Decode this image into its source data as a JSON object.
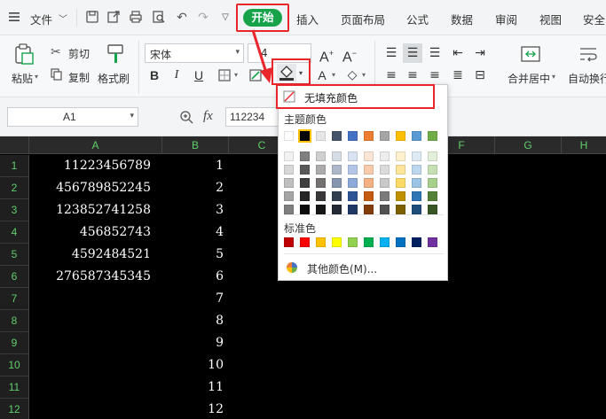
{
  "menubar": {
    "file_label": "文件",
    "tabs": [
      "开始",
      "插入",
      "页面布局",
      "公式",
      "数据",
      "审阅",
      "视图",
      "安全"
    ]
  },
  "ribbon": {
    "paste": "粘贴",
    "cut": "剪切",
    "copy": "复制",
    "format_painter": "格式刷",
    "font_name": "宋体",
    "font_size": "4",
    "merge_center": "合并居中",
    "auto_wrap": "自动换行"
  },
  "formula": {
    "cell_ref": "A1",
    "fx": "fx",
    "value": "112234"
  },
  "columns": [
    "A",
    "B",
    "C",
    "D",
    "E",
    "F",
    "G",
    "H"
  ],
  "rows": [
    "1",
    "2",
    "3",
    "4",
    "5",
    "6",
    "7",
    "8",
    "9",
    "10",
    "11",
    "12"
  ],
  "col_a": [
    "11223456789",
    "456789852245",
    "123852741258",
    "456852743",
    "4592484521",
    "276587345345"
  ],
  "col_b": [
    "1",
    "2",
    "3",
    "4",
    "5",
    "6",
    "7",
    "8",
    "9",
    "10",
    "11",
    "12"
  ],
  "popup": {
    "no_fill": "无填充颜色",
    "theme_colors": "主题颜色",
    "standard_colors": "标准色",
    "more_colors": "其他颜色(M)..."
  },
  "colors": {
    "accent_green": "#16a34a",
    "highlight_red": "#e8262b",
    "row_col_header_text": "#5fcf6a",
    "theme_top_row": [
      "#ffffff",
      "#000000",
      "#e7e6e6",
      "#44546a",
      "#4472c4",
      "#ed7d31",
      "#a5a5a5",
      "#ffc000",
      "#5b9bd5",
      "#70ad47"
    ],
    "standard": [
      "#c00000",
      "#ff0000",
      "#ffc000",
      "#ffff00",
      "#92d050",
      "#00b050",
      "#00b0f0",
      "#0070c0",
      "#002060",
      "#7030a0"
    ]
  }
}
